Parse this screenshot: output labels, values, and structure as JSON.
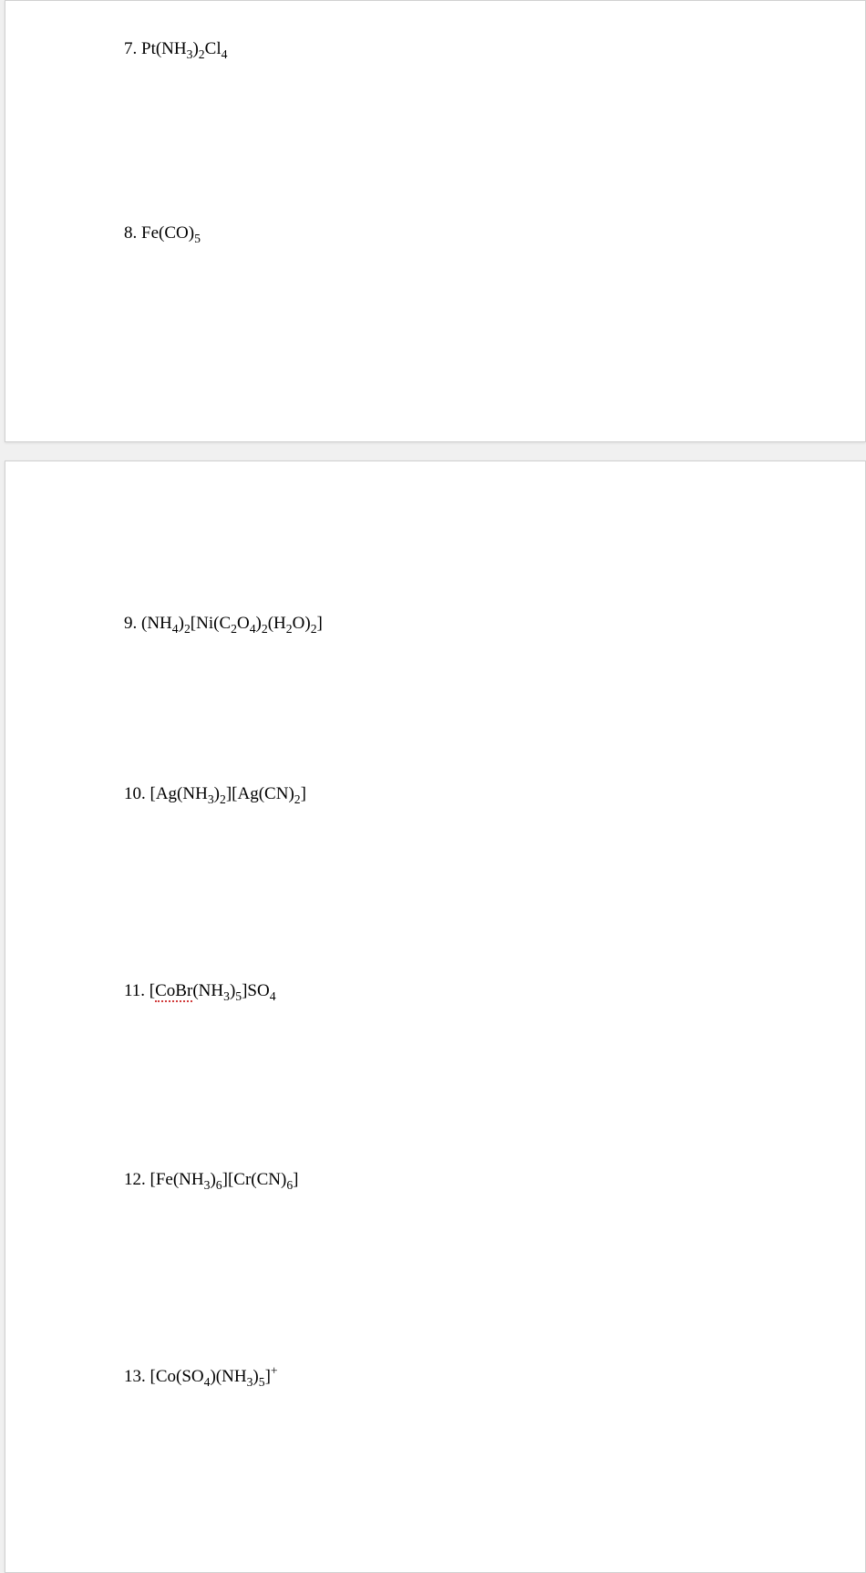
{
  "items": [
    {
      "num": "7.",
      "parts": [
        {
          "t": " Pt(NH"
        },
        {
          "t": "3",
          "sub": true
        },
        {
          "t": ")"
        },
        {
          "t": "2",
          "sub": true
        },
        {
          "t": "Cl"
        },
        {
          "t": "4",
          "sub": true
        }
      ],
      "cls": "item7",
      "page": 1
    },
    {
      "num": "8.",
      "parts": [
        {
          "t": " Fe(CO)"
        },
        {
          "t": "5",
          "sub": true
        }
      ],
      "cls": "item8",
      "page": 1
    },
    {
      "num": "9.",
      "parts": [
        {
          "t": " (NH"
        },
        {
          "t": "4",
          "sub": true
        },
        {
          "t": ")"
        },
        {
          "t": "2",
          "sub": true
        },
        {
          "t": "[Ni(C"
        },
        {
          "t": "2",
          "sub": true
        },
        {
          "t": "O"
        },
        {
          "t": "4",
          "sub": true
        },
        {
          "t": ")"
        },
        {
          "t": "2",
          "sub": true
        },
        {
          "t": "(H"
        },
        {
          "t": "2",
          "sub": true
        },
        {
          "t": "O)"
        },
        {
          "t": "2",
          "sub": true
        },
        {
          "t": "]"
        }
      ],
      "cls": "item9",
      "page": 2
    },
    {
      "num": "10.",
      "parts": [
        {
          "t": " [Ag(NH"
        },
        {
          "t": "3",
          "sub": true
        },
        {
          "t": ")"
        },
        {
          "t": "2",
          "sub": true
        },
        {
          "t": "][Ag(CN)"
        },
        {
          "t": "2",
          "sub": true
        },
        {
          "t": "]"
        }
      ],
      "cls": "item10",
      "page": 2
    },
    {
      "num": "11.",
      "parts": [
        {
          "t": " ["
        },
        {
          "t": "CoBr",
          "spell": true
        },
        {
          "t": "(NH"
        },
        {
          "t": "3",
          "sub": true
        },
        {
          "t": ")"
        },
        {
          "t": "5",
          "sub": true
        },
        {
          "t": "]SO"
        },
        {
          "t": "4",
          "sub": true
        }
      ],
      "cls": "item11",
      "page": 2
    },
    {
      "num": "12.",
      "parts": [
        {
          "t": " [Fe(NH"
        },
        {
          "t": "3",
          "sub": true
        },
        {
          "t": ")"
        },
        {
          "t": "6",
          "sub": true
        },
        {
          "t": "][Cr(CN)"
        },
        {
          "t": "6",
          "sub": true
        },
        {
          "t": "]"
        }
      ],
      "cls": "item12",
      "page": 2
    },
    {
      "num": "13.",
      "parts": [
        {
          "t": " [Co(SO"
        },
        {
          "t": "4",
          "sub": true
        },
        {
          "t": ")(NH"
        },
        {
          "t": "3",
          "sub": true
        },
        {
          "t": ")"
        },
        {
          "t": "5",
          "sub": true
        },
        {
          "t": "]"
        },
        {
          "t": "+",
          "sup": true
        }
      ],
      "cls": "item13",
      "page": 2
    }
  ]
}
